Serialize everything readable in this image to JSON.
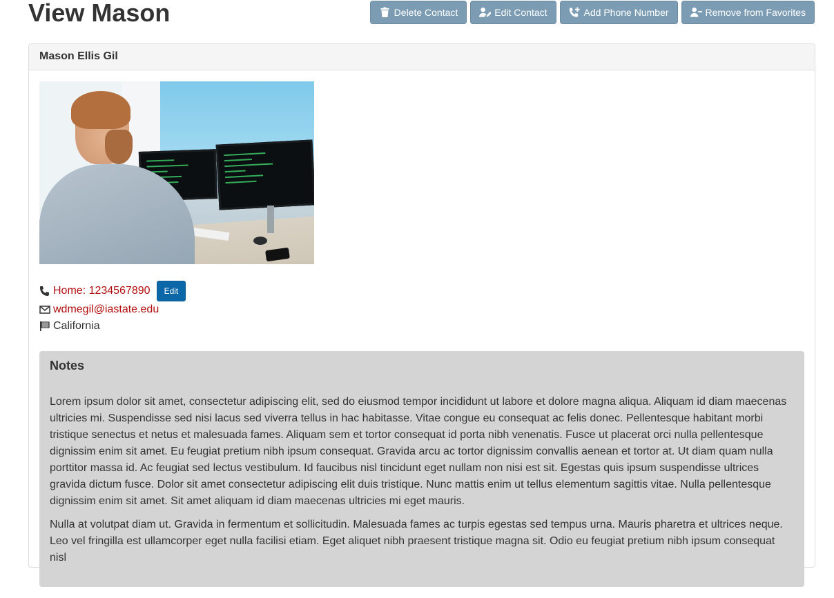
{
  "page": {
    "title": "View Mason"
  },
  "actions": [
    {
      "label": "Delete Contact",
      "icon": "trash-icon"
    },
    {
      "label": "Edit Contact",
      "icon": "user-edit-icon"
    },
    {
      "label": "Add Phone Number",
      "icon": "phone-plus-icon"
    },
    {
      "label": "Remove from Favorites",
      "icon": "user-minus-icon"
    }
  ],
  "contact": {
    "full_name": "Mason Ellis Gil",
    "phone_label": "Home: 1234567890",
    "phone_edit_label": "Edit",
    "email": "wdmegil@iastate.edu",
    "state": "California"
  },
  "notes": {
    "title": "Notes",
    "paragraphs": [
      "Lorem ipsum dolor sit amet, consectetur adipiscing elit, sed do eiusmod tempor incididunt ut labore et dolore magna aliqua. Aliquam id diam maecenas ultricies mi. Suspendisse sed nisi lacus sed viverra tellus in hac habitasse. Vitae congue eu consequat ac felis donec. Pellentesque habitant morbi tristique senectus et netus et malesuada fames. Aliquam sem et tortor consequat id porta nibh venenatis. Fusce ut placerat orci nulla pellentesque dignissim enim sit amet. Eu feugiat pretium nibh ipsum consequat. Gravida arcu ac tortor dignissim convallis aenean et tortor at. Ut diam quam nulla porttitor massa id. Ac feugiat sed lectus vestibulum. Id faucibus nisl tincidunt eget nullam non nisi est sit. Egestas quis ipsum suspendisse ultrices gravida dictum fusce. Dolor sit amet consectetur adipiscing elit duis tristique. Nunc mattis enim ut tellus elementum sagittis vitae. Nulla pellentesque dignissim enim sit amet. Sit amet aliquam id diam maecenas ultricies mi eget mauris.",
      "Nulla at volutpat diam ut. Gravida in fermentum et sollicitudin. Malesuada fames ac turpis egestas sed tempus urna. Mauris pharetra et ultrices neque. Leo vel fringilla est ullamcorper eget nulla facilisi etiam. Eget aliquet nibh praesent tristique magna sit. Odio eu feugiat pretium nibh ipsum consequat nisl"
    ]
  },
  "colors": {
    "action_button": "#7c9cb3",
    "edit_button": "#0c67a8",
    "link": "#b40d0d",
    "notes_bg": "#d4d4d4"
  }
}
